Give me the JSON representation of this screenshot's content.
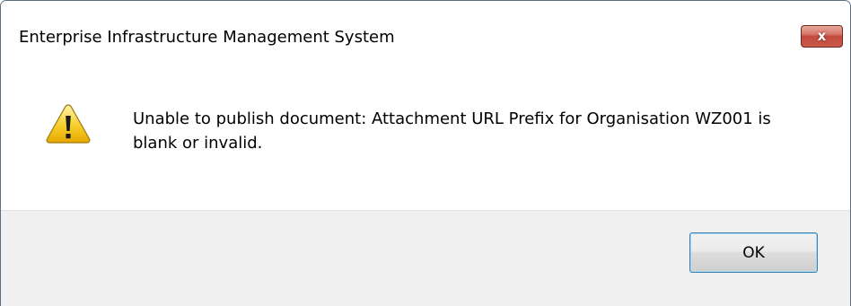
{
  "window": {
    "title": "Enterprise Infrastructure Management System",
    "close_label": "x"
  },
  "message": {
    "icon": "warning-icon",
    "text": "Unable to publish document: Attachment URL Prefix for Organisation WZ001 is blank or invalid."
  },
  "buttons": {
    "ok_label": "OK"
  },
  "colors": {
    "close_button": "#c24a3b",
    "footer_background": "#f0f0f0",
    "warning_yellow": "#f5c400"
  }
}
